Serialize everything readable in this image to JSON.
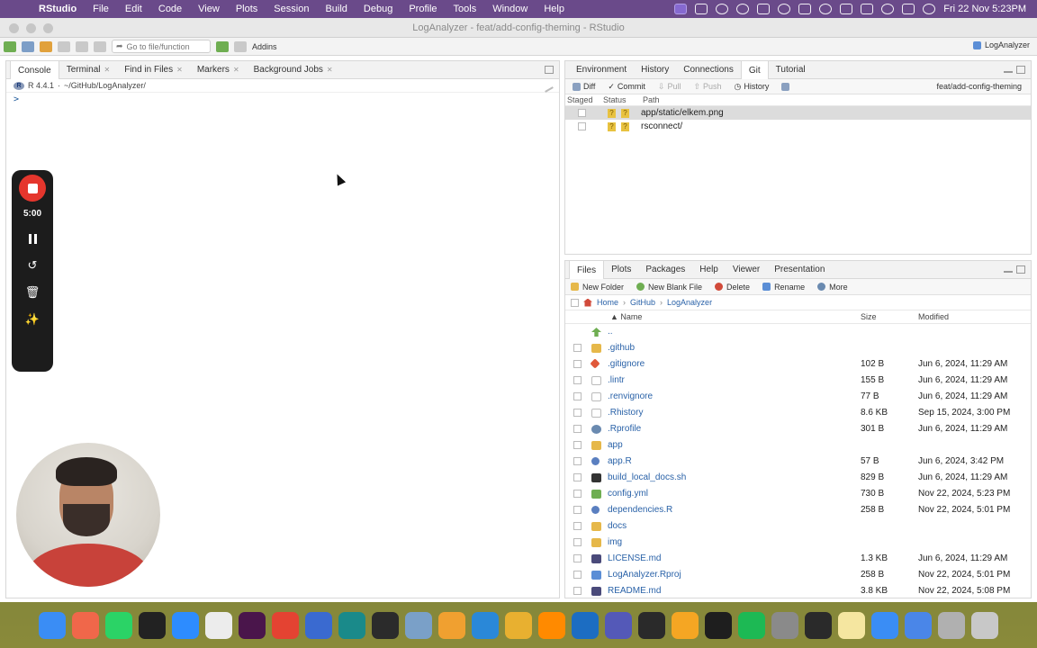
{
  "menubar": {
    "app_name": "RStudio",
    "menus": [
      "File",
      "Edit",
      "Code",
      "View",
      "Plots",
      "Session",
      "Build",
      "Debug",
      "Profile",
      "Tools",
      "Window",
      "Help"
    ],
    "clock": "Fri 22 Nov  5:23PM"
  },
  "window": {
    "title": "LogAnalyzer - feat/add-config-theming - RStudio"
  },
  "toolbar": {
    "goto_placeholder": "Go to file/function",
    "addins_label": "Addins",
    "project_label": "LogAnalyzer"
  },
  "console_pane": {
    "tabs": [
      {
        "label": "Console",
        "active": true
      },
      {
        "label": "Terminal"
      },
      {
        "label": "Find in Files"
      },
      {
        "label": "Markers"
      },
      {
        "label": "Background Jobs"
      }
    ],
    "r_version": "R 4.4.1",
    "working_dir": "~/GitHub/LogAnalyzer/",
    "prompt": ">"
  },
  "recorder": {
    "time": "5:00"
  },
  "env_pane": {
    "tabs": [
      {
        "label": "Environment"
      },
      {
        "label": "History"
      },
      {
        "label": "Connections"
      },
      {
        "label": "Git",
        "active": true
      },
      {
        "label": "Tutorial"
      }
    ],
    "toolbar": {
      "diff": "Diff",
      "commit": "Commit",
      "pull": "Pull",
      "push": "Push",
      "history": "History",
      "branch": "feat/add-config-theming"
    },
    "columns": [
      "Staged",
      "Status",
      "Path"
    ],
    "rows": [
      {
        "status": [
          "?",
          "?"
        ],
        "path": "app/static/elkem.png",
        "selected": true
      },
      {
        "status": [
          "?",
          "?"
        ],
        "path": "rsconnect/"
      }
    ]
  },
  "files_pane": {
    "tabs": [
      {
        "label": "Files",
        "active": true
      },
      {
        "label": "Plots"
      },
      {
        "label": "Packages"
      },
      {
        "label": "Help"
      },
      {
        "label": "Viewer"
      },
      {
        "label": "Presentation"
      }
    ],
    "toolbar": {
      "new_folder": "New Folder",
      "new_blank_file": "New Blank File",
      "delete": "Delete",
      "rename": "Rename",
      "more": "More"
    },
    "breadcrumb": [
      "Home",
      "GitHub",
      "LogAnalyzer"
    ],
    "columns": {
      "name": "Name",
      "size": "Size",
      "modified": "Modified"
    },
    "rows": [
      {
        "name": "..",
        "icon": "up-arrow",
        "size": "",
        "modified": ""
      },
      {
        "name": ".github",
        "icon": "folder",
        "size": "",
        "modified": ""
      },
      {
        "name": ".gitignore",
        "icon": "git",
        "size": "102 B",
        "modified": "Jun 6, 2024, 11:29 AM"
      },
      {
        "name": ".lintr",
        "icon": "doc",
        "size": "155 B",
        "modified": "Jun 6, 2024, 11:29 AM"
      },
      {
        "name": ".renvignore",
        "icon": "doc",
        "size": "77 B",
        "modified": "Jun 6, 2024, 11:29 AM"
      },
      {
        "name": ".Rhistory",
        "icon": "doc",
        "size": "8.6 KB",
        "modified": "Sep 15, 2024, 3:00 PM"
      },
      {
        "name": ".Rprofile",
        "icon": "gear",
        "size": "301 B",
        "modified": "Jun 6, 2024, 11:29 AM"
      },
      {
        "name": "app",
        "icon": "folder",
        "size": "",
        "modified": ""
      },
      {
        "name": "app.R",
        "icon": "r",
        "size": "57 B",
        "modified": "Jun 6, 2024, 3:42 PM"
      },
      {
        "name": "build_local_docs.sh",
        "icon": "sh",
        "size": "829 B",
        "modified": "Jun 6, 2024, 11:29 AM"
      },
      {
        "name": "config.yml",
        "icon": "yml",
        "size": "730 B",
        "modified": "Nov 22, 2024, 5:23 PM"
      },
      {
        "name": "dependencies.R",
        "icon": "r",
        "size": "258 B",
        "modified": "Nov 22, 2024, 5:01 PM"
      },
      {
        "name": "docs",
        "icon": "folder",
        "size": "",
        "modified": ""
      },
      {
        "name": "img",
        "icon": "folder",
        "size": "",
        "modified": ""
      },
      {
        "name": "LICENSE.md",
        "icon": "md",
        "size": "1.3 KB",
        "modified": "Jun 6, 2024, 11:29 AM"
      },
      {
        "name": "LogAnalyzer.Rproj",
        "icon": "proj",
        "size": "258 B",
        "modified": "Nov 22, 2024, 5:01 PM"
      },
      {
        "name": "README.md",
        "icon": "md",
        "size": "3.8 KB",
        "modified": "Nov 22, 2024, 5:08 PM"
      }
    ]
  },
  "dock": {
    "apps": [
      "finder",
      "launchpad",
      "whatsapp",
      "remarkable",
      "zoom",
      "chatgpt",
      "slack",
      "todoist",
      "rstudio-blue",
      "screenshot",
      "sublime",
      "rstudio",
      "fantastical",
      "vscode",
      "chrome",
      "sublime-text",
      "outlook",
      "teams",
      "terminal",
      "tableplus",
      "figma",
      "spotify",
      "system-settings",
      "activity-monitor",
      "notes",
      "finder-2",
      "chrome-2",
      "script-editor",
      "trash"
    ],
    "colors": [
      "#3a8df5",
      "#f0674a",
      "#2bd366",
      "#222222",
      "#2d8cff",
      "#ececec",
      "#4a154b",
      "#e44332",
      "#3a6ad0",
      "#1a8a8a",
      "#2b2b2b",
      "#7aa0c8",
      "#f0a030",
      "#2a88d8",
      "#e8b030",
      "#ff8a00",
      "#1c6dc2",
      "#5459b8",
      "#2a2a2a",
      "#f5a623",
      "#1e1e1e",
      "#1db954",
      "#8a8a8a",
      "#2a2a2a",
      "#f5e6a0",
      "#3a8df5",
      "#4a86e8",
      "#b0b0b0",
      "#c8c8c8"
    ]
  }
}
